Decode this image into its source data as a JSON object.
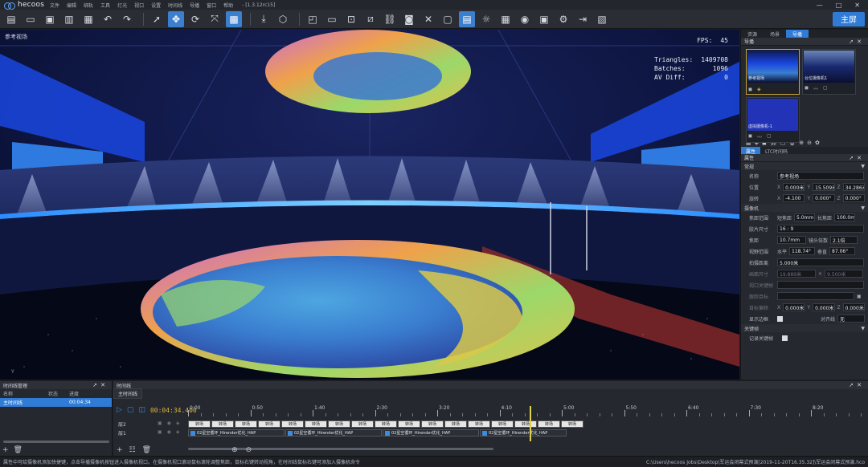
{
  "app": {
    "name": "hecoos",
    "version": "- [1.3.12rc15]",
    "menu": [
      "文件",
      "编辑",
      "绑轨",
      "工具",
      "灯光",
      "视口",
      "设置",
      "时间线",
      "导播",
      "窗口",
      "帮助"
    ],
    "window_controls": [
      "—",
      "□",
      "✕"
    ],
    "workspace_label": "主屏"
  },
  "toolbar": {
    "icons": [
      "new-file-icon",
      "open-folder-icon",
      "save-icon",
      "save-as-icon",
      "library-icon",
      "undo-icon",
      "redo-icon",
      "select-icon",
      "move-icon",
      "rotate-icon",
      "scale-icon",
      "grid-icon",
      "import-icon",
      "cube-icon",
      "view-mode-icon",
      "screen-icon",
      "focus-icon",
      "measure-icon",
      "link-icon",
      "camera-icon",
      "tools-icon",
      "monitor-icon",
      "light-icon",
      "mask-icon",
      "render-icon",
      "layers-icon",
      "settings-icon",
      "export-icon",
      "output-icon"
    ]
  },
  "viewport": {
    "title": "参考视场",
    "fps_label": "FPS:",
    "fps_value": "45",
    "triangles_label": "Triangles:",
    "triangles_value": "1409708",
    "batches_label": "Batches:",
    "batches_value": "1096",
    "av_diff_label": "AV Diff:",
    "av_diff_value": "0",
    "axis_label": "Y"
  },
  "right_panel": {
    "tabs": [
      "资源",
      "场景",
      "导播"
    ],
    "active_tab": 2,
    "section_title": "导播",
    "cameras": [
      {
        "label": "参考视场",
        "selected": true
      },
      {
        "label": "台位摄像机1",
        "selected": false
      },
      {
        "label": "虚拟摄像机-1",
        "selected": false
      }
    ],
    "prop_tabs": [
      "属性",
      "LTC时间码"
    ],
    "prop_header": "属性",
    "groups": {
      "basic": "常规",
      "camera": "摄像机",
      "keyframe": "关键帧"
    },
    "fields": {
      "name_label": "名称",
      "name_value": "参考视场",
      "pos_label": "位置",
      "pos_x": "0.000米",
      "pos_y": "15.509米",
      "pos_z": "34.286米",
      "rot_label": "旋转",
      "rot_x": "-4.100",
      "rot_y": "0.000°",
      "rot_z": "0.000°",
      "focal_label": "焦距范围",
      "focal_short_label": "短焦距",
      "focal_short": "5.0mm",
      "focal_long_label": "长焦距",
      "focal_long": "100.0mm",
      "sensor_label": "胶片尺寸",
      "sensor_value": "16 : 9",
      "focus_label": "焦距",
      "focus_value": "10.7mm",
      "zoom_label": "镜头倍数",
      "zoom_value": "2.1倍",
      "fov_label": "视野范围",
      "fov_h_label": "水平",
      "fov_h": "118.74°",
      "fov_v_label": "垂直",
      "fov_v": "87.06°",
      "dist_label": "拍摄距离",
      "dist_value": "5.000米",
      "aperture_label": "画面尺寸",
      "aperture_w": "19.889米",
      "aperture_h": "9.500米",
      "bind_label": "视口关键帧",
      "target_label": "跟踪目标",
      "offset_label": "目标偏移",
      "offset_x": "0.000米",
      "offset_y": "0.000米",
      "offset_z": "0.000米",
      "show_border_label": "显示边框",
      "align_label": "对齐线",
      "align_value": "无",
      "record_key_label": "记录关键帧"
    }
  },
  "timeline_manager": {
    "title": "时间线管理",
    "columns": [
      "名称",
      "状态",
      "进度"
    ],
    "rows": [
      {
        "name": "主时间线",
        "status": "",
        "progress": "00:04:34"
      }
    ]
  },
  "timeline": {
    "title": "时间线",
    "tab": "主时间线",
    "current_time": "00:04:34.400",
    "ruler": [
      "0:00",
      "0:50",
      "1:40",
      "2:30",
      "3:20",
      "4:10",
      "5:00",
      "5:50",
      "6:40",
      "7:30",
      "8:20"
    ],
    "tracks": [
      "层2",
      "层1"
    ],
    "transition_label": "转场",
    "clip_label": "02星空循环_Hirender优化_HAP",
    "playhead_seconds": 274.4,
    "duration_seconds": 500
  },
  "status_bar": {
    "hint": "属性中可给摄像机添加快捷键，点击导播摄像机按钮进入摄像机视口。在摄像机视口滚动鼠标滚轮调整焦距，鼠标右键转动视角，在时间线鼠标右键可添加入摄像机命令",
    "path": "C:\\Users\\hecoos Jobs\\Desktop\\军运会闭幕式预演[2019-11-20T16.35.32]\\军运会闭幕式预演.hco"
  },
  "colors": {
    "accent": "#2f7bd6",
    "playhead": "#e0d34a",
    "time": "#e0b43a"
  }
}
